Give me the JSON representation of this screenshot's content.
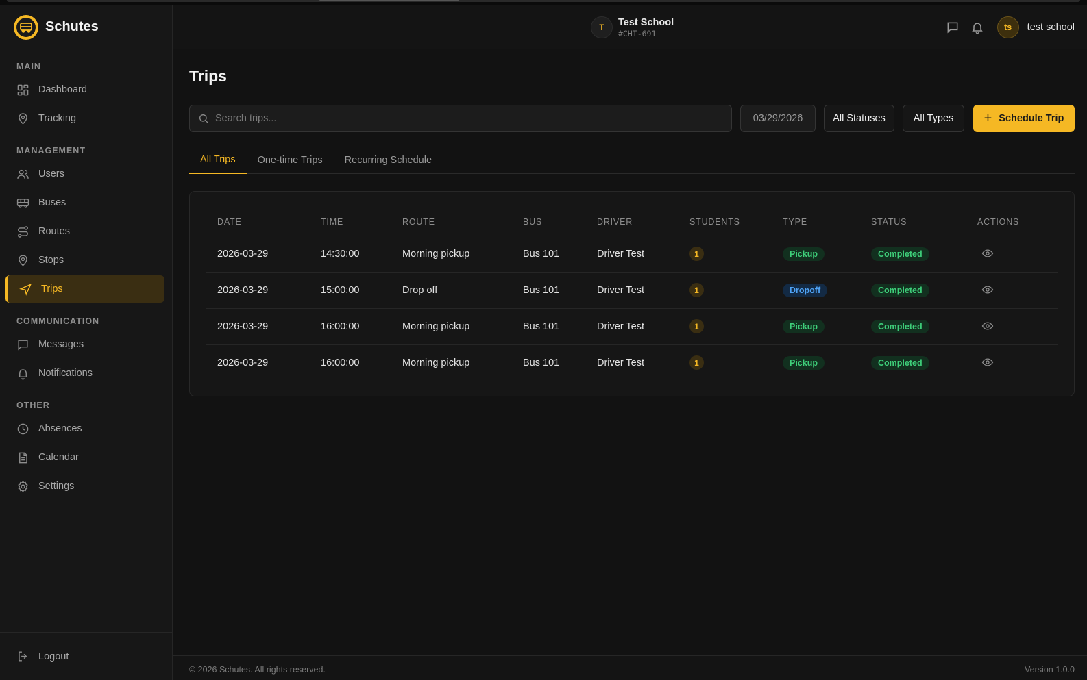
{
  "brand": {
    "name": "Schutes",
    "accent": "#f5b824"
  },
  "sidebar": {
    "sections": [
      {
        "title": "MAIN",
        "items": [
          {
            "label": "Dashboard",
            "icon": "dashboard-icon"
          },
          {
            "label": "Tracking",
            "icon": "map-pin-icon"
          }
        ]
      },
      {
        "title": "MANAGEMENT",
        "items": [
          {
            "label": "Users",
            "icon": "users-icon"
          },
          {
            "label": "Buses",
            "icon": "bus-icon"
          },
          {
            "label": "Routes",
            "icon": "route-icon"
          },
          {
            "label": "Stops",
            "icon": "map-pin-icon"
          },
          {
            "label": "Trips",
            "icon": "navigation-icon",
            "active": true
          }
        ]
      },
      {
        "title": "COMMUNICATION",
        "items": [
          {
            "label": "Messages",
            "icon": "message-icon"
          },
          {
            "label": "Notifications",
            "icon": "bell-icon"
          }
        ]
      },
      {
        "title": "OTHER",
        "items": [
          {
            "label": "Absences",
            "icon": "clock-icon"
          },
          {
            "label": "Calendar",
            "icon": "document-icon"
          },
          {
            "label": "Settings",
            "icon": "gear-icon"
          }
        ]
      }
    ],
    "logout_label": "Logout"
  },
  "header": {
    "school_initial": "T",
    "school_name": "Test School",
    "school_code": "#CHT-691",
    "user_initials": "ts",
    "user_name": "test school"
  },
  "page": {
    "title": "Trips",
    "search_placeholder": "Search trips...",
    "date_value": "03/29/2026",
    "status_filter": "All Statuses",
    "type_filter": "All Types",
    "schedule_label": "Schedule Trip"
  },
  "tabs": [
    {
      "label": "All Trips",
      "active": true
    },
    {
      "label": "One-time Trips",
      "active": false
    },
    {
      "label": "Recurring Schedule",
      "active": false
    }
  ],
  "table": {
    "columns": [
      "DATE",
      "TIME",
      "ROUTE",
      "BUS",
      "DRIVER",
      "STUDENTS",
      "TYPE",
      "STATUS",
      "ACTIONS"
    ],
    "rows": [
      {
        "date": "2026-03-29",
        "time": "14:30:00",
        "route": "Morning pickup",
        "bus": "Bus 101",
        "driver": "Driver Test",
        "students": "1",
        "type": "Pickup",
        "status": "Completed"
      },
      {
        "date": "2026-03-29",
        "time": "15:00:00",
        "route": "Drop off",
        "bus": "Bus 101",
        "driver": "Driver Test",
        "students": "1",
        "type": "Dropoff",
        "status": "Completed"
      },
      {
        "date": "2026-03-29",
        "time": "16:00:00",
        "route": "Morning pickup",
        "bus": "Bus 101",
        "driver": "Driver Test",
        "students": "1",
        "type": "Pickup",
        "status": "Completed"
      },
      {
        "date": "2026-03-29",
        "time": "16:00:00",
        "route": "Morning pickup",
        "bus": "Bus 101",
        "driver": "Driver Test",
        "students": "1",
        "type": "Pickup",
        "status": "Completed"
      }
    ]
  },
  "footer": {
    "copyright": "© 2026 Schutes. All rights reserved.",
    "version": "Version 1.0.0"
  }
}
